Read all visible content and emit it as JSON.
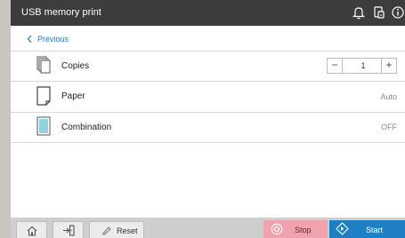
{
  "title_bar": {
    "title": "USB memory print",
    "buttons": [
      "bell-icon",
      "device-icon",
      "info-icon"
    ]
  },
  "nav": {
    "previous_label": "Previous"
  },
  "settings": [
    {
      "label": "Copies",
      "icon": "copies-icon",
      "value": "1"
    },
    {
      "label": "Paper",
      "icon": "paper-icon",
      "value": "Auto"
    },
    {
      "label": "Combination",
      "icon": "combination-icon",
      "value": "OFF"
    }
  ],
  "stepper": {
    "minus": "−",
    "plus": "+"
  },
  "footer": {
    "reset_label": "Reset",
    "stop_label": "Stop",
    "start_label": "Start"
  },
  "colors": {
    "title_bar": "#3c3c3c",
    "link": "#1f7bc6",
    "stop": "#f0a2ad",
    "start": "#1f7fc4",
    "combination_fill": "#8fd3df"
  }
}
